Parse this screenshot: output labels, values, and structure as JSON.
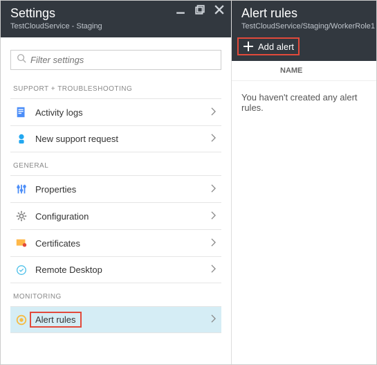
{
  "left": {
    "title": "Settings",
    "subtitle": "TestCloudService - Staging",
    "search_placeholder": "Filter settings",
    "groups": [
      {
        "key": "support",
        "label": "SUPPORT + TROUBLESHOOTING"
      },
      {
        "key": "general",
        "label": "GENERAL"
      },
      {
        "key": "monitoring",
        "label": "MONITORING"
      }
    ],
    "items": {
      "activity": "Activity logs",
      "support": "New support request",
      "props": "Properties",
      "config": "Configuration",
      "certs": "Certificates",
      "rdp": "Remote Desktop",
      "alerts": "Alert rules"
    }
  },
  "right": {
    "title": "Alert rules",
    "subtitle": "TestCloudService/Staging/WorkerRole1",
    "add_label": "Add alert",
    "col_name": "NAME",
    "empty_msg": "You haven't created any alert rules."
  }
}
